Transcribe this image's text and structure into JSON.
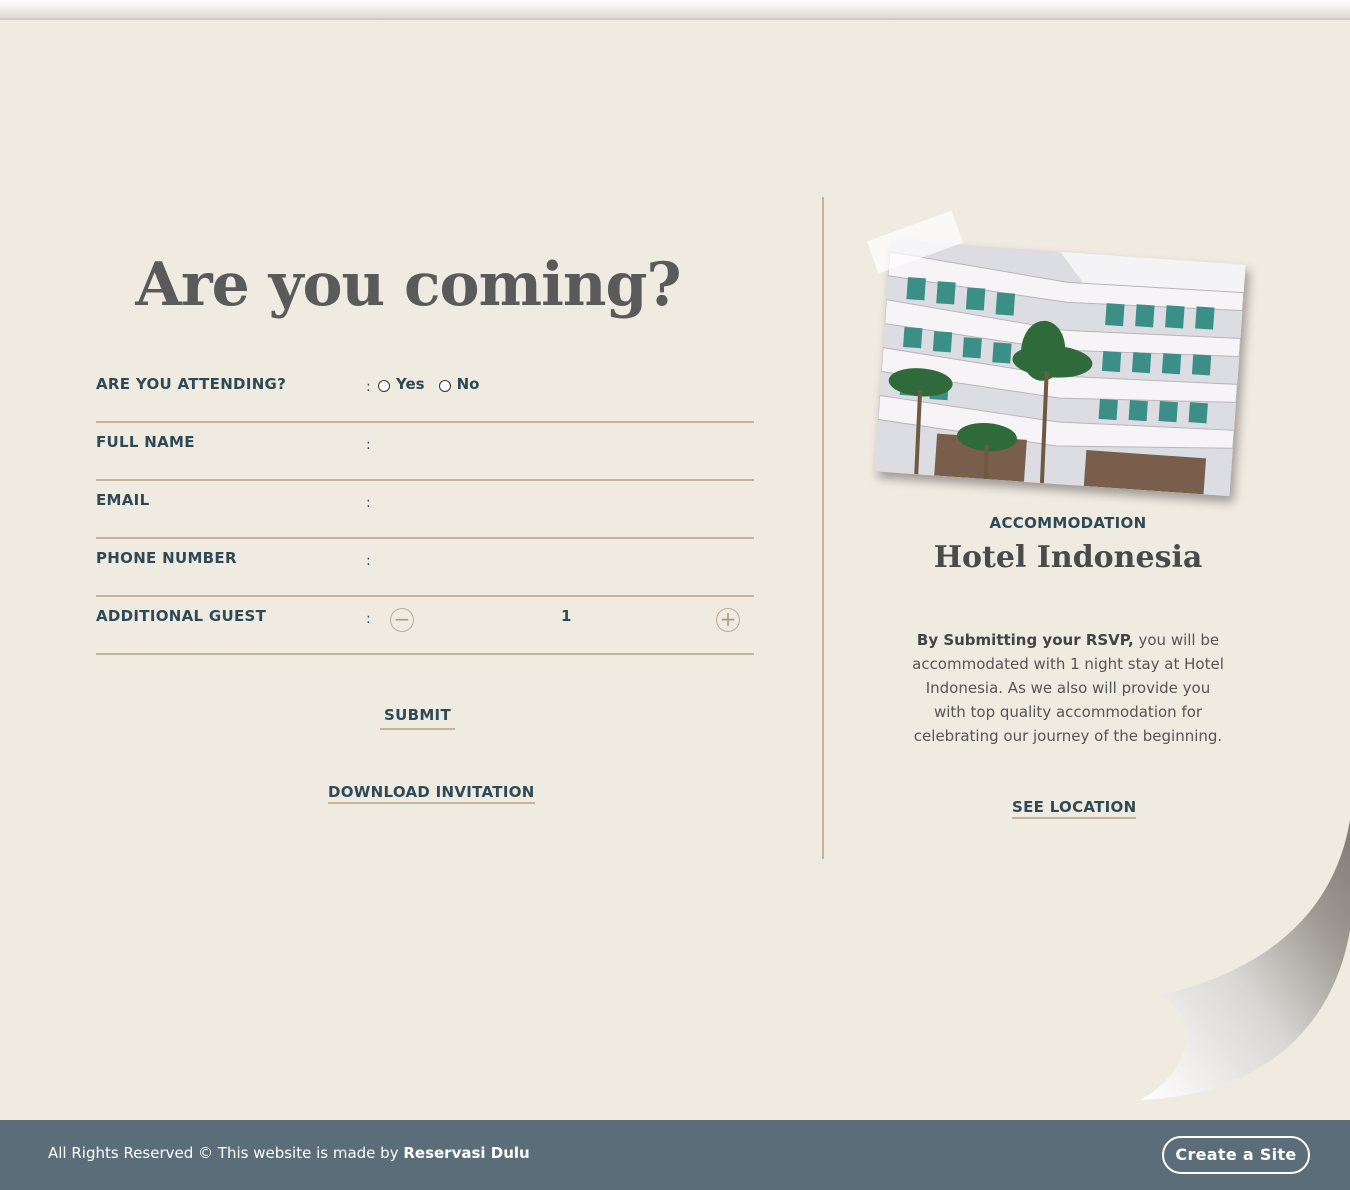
{
  "rsvp": {
    "heading": "Are you coming?",
    "attending_label": "ARE YOU ATTENDING?",
    "yes_label": "Yes",
    "no_label": "No",
    "full_name_label": "FULL NAME",
    "email_label": "EMAIL",
    "phone_label": "PHONE NUMBER",
    "additional_guest_label": "ADDITIONAL GUEST",
    "separator": ":",
    "additional_guest_value": "1",
    "submit_label": "SUBMIT",
    "download_label": "DOWNLOAD INVITATION"
  },
  "accommodation": {
    "section_label": "ACCOMMODATION",
    "hotel_name": "Hotel Indonesia",
    "desc_bold": "By Submitting your RSVP,",
    "desc_rest": " you will be accommodated with 1 night stay at Hotel Indonesia. As we also will provide you with top quality accommodation for celebrating our journey of the beginning.",
    "see_location_label": "SEE LOCATION"
  },
  "footer": {
    "text_prefix": "All Rights Reserved © This website is made by ",
    "brand": "Reservasi Dulu",
    "create_site_label": "Create a Site"
  },
  "colors": {
    "background": "#f0ebe1",
    "text_dark": "#2e4a57",
    "underline": "#c8b29a",
    "footer": "#5a6d79"
  },
  "icons": {
    "minus": "minus-circle-icon",
    "plus": "plus-circle-icon"
  }
}
